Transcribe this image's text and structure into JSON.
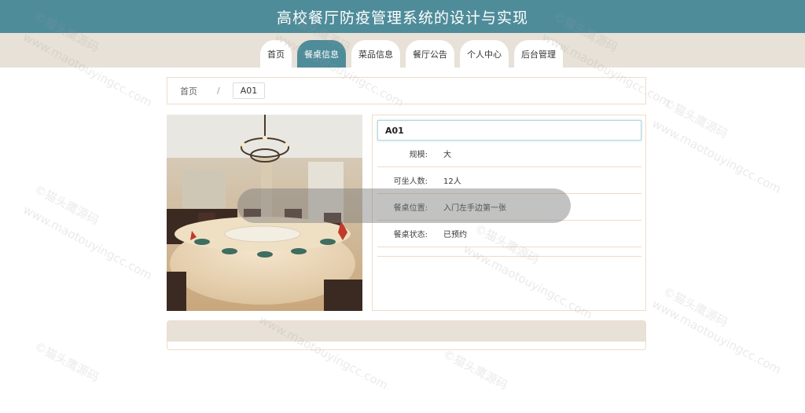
{
  "header": {
    "title": "高校餐厅防疫管理系统的设计与实现"
  },
  "nav": {
    "items": [
      {
        "label": "首页",
        "active": false
      },
      {
        "label": "餐桌信息",
        "active": true
      },
      {
        "label": "菜品信息",
        "active": false
      },
      {
        "label": "餐厅公告",
        "active": false
      },
      {
        "label": "个人中心",
        "active": false
      },
      {
        "label": "后台管理",
        "active": false
      }
    ]
  },
  "breadcrumb": {
    "home": "首页",
    "separator": "/",
    "current": "A01"
  },
  "table_detail": {
    "name": "A01",
    "fields": [
      {
        "label": "规模:",
        "value": "大"
      },
      {
        "label": "可坐人数:",
        "value": "12人"
      },
      {
        "label": "餐桌位置:",
        "value": "入门左手边第一张"
      },
      {
        "label": "餐桌状态:",
        "value": "已预约"
      }
    ]
  },
  "watermark": {
    "line1": "©猫头鹰源码",
    "line2": "www.maotouyingcc.com"
  },
  "colors": {
    "accent": "#4f8c9a",
    "band": "#e7e1d7",
    "border": "#efdcc8"
  }
}
